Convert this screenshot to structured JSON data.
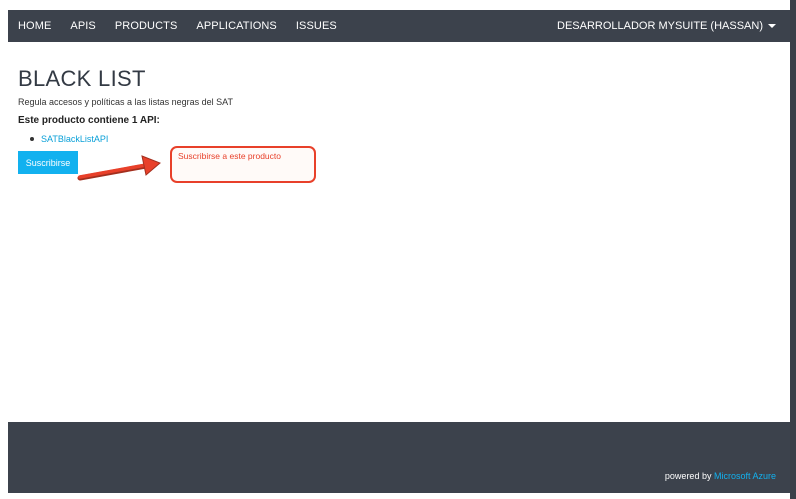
{
  "nav": {
    "items": [
      "HOME",
      "APIS",
      "PRODUCTS",
      "APPLICATIONS",
      "ISSUES"
    ],
    "user_label": "DESARROLLADOR MYSUITE (HASSAN)"
  },
  "product": {
    "title": "BLACK LIST",
    "description": "Regula accesos y políticas a las listas negras del SAT",
    "contains_label": "Este producto contiene 1 API:",
    "apis": [
      "SATBlackListAPI"
    ],
    "subscribe_label": "Suscribirse"
  },
  "annotation": {
    "text": "Suscribirse a este producto",
    "color": "#e8402a"
  },
  "footer": {
    "powered_prefix": "powered by",
    "powered_brand": "Microsoft Azure"
  },
  "colors": {
    "nav_bg": "#3c424c",
    "accent": "#12b1ef"
  }
}
